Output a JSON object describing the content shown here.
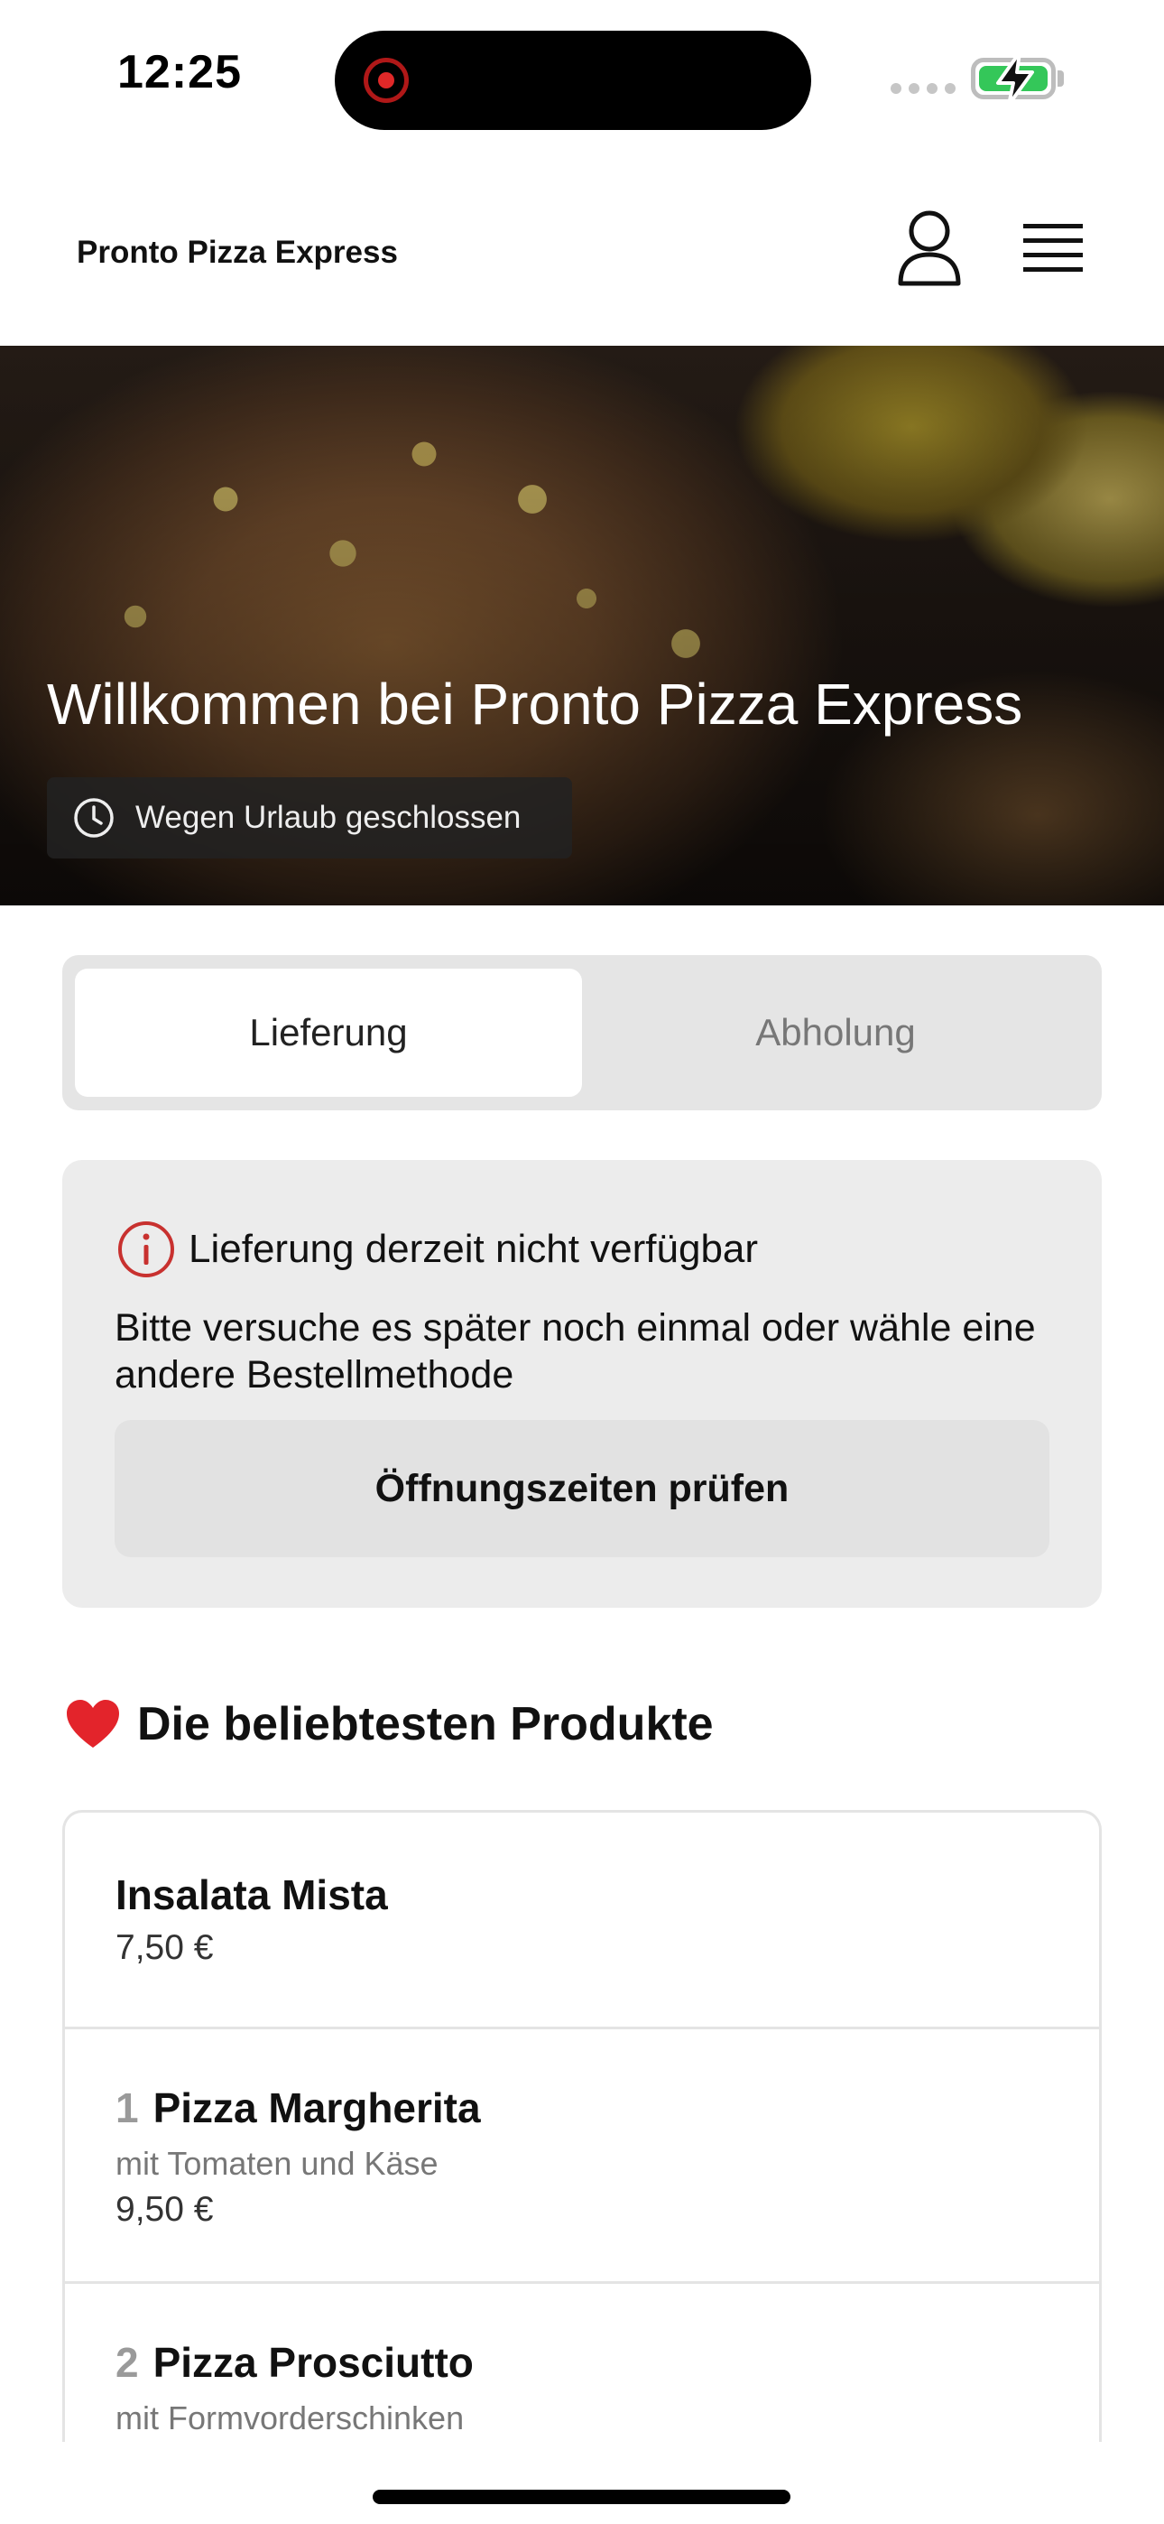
{
  "status_bar": {
    "time": "12:25"
  },
  "header": {
    "brand": "Pronto Pizza Express",
    "icons": [
      "user-icon",
      "menu-icon"
    ]
  },
  "hero": {
    "title": "Willkommen bei Pronto Pizza Express",
    "status": "Wegen Urlaub geschlossen"
  },
  "order_mode": {
    "tabs": [
      {
        "label": "Lieferung",
        "selected": true
      },
      {
        "label": "Abholung",
        "selected": false
      }
    ]
  },
  "notice": {
    "title": "Lieferung derzeit nicht verfügbar",
    "body": "Bitte versuche es später noch einmal oder wähle eine andere Bestellmethode",
    "button": "Öffnungszeiten prüfen"
  },
  "popular": {
    "title": "Die beliebtesten Produkte",
    "products": [
      {
        "number": "",
        "name": "Insalata Mista",
        "description": "",
        "price": "7,50 €"
      },
      {
        "number": "1",
        "name": "Pizza Margherita",
        "description": "mit Tomaten und Käse",
        "price": "9,50 €"
      },
      {
        "number": "2",
        "name": "Pizza Prosciutto",
        "description": "mit Formvorderschinken",
        "price": ""
      }
    ]
  },
  "colors": {
    "accent_red": "#c8312f",
    "battery_green": "#34c759",
    "panel_gray": "#ececec"
  }
}
